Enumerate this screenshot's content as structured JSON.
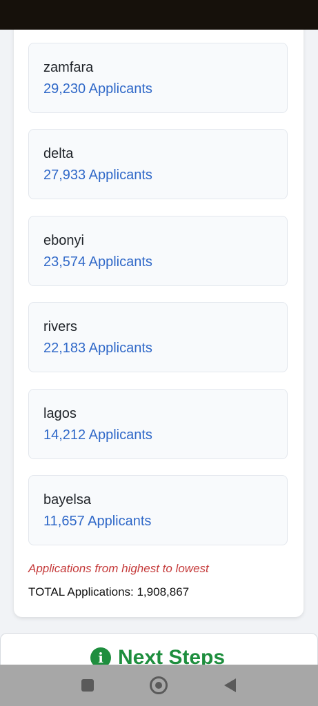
{
  "states": [
    {
      "name": "zamfara",
      "count": "29,230 Applicants"
    },
    {
      "name": "delta",
      "count": "27,933 Applicants"
    },
    {
      "name": "ebonyi",
      "count": "23,574 Applicants"
    },
    {
      "name": "rivers",
      "count": "22,183 Applicants"
    },
    {
      "name": "lagos",
      "count": "14,212 Applicants"
    },
    {
      "name": "bayelsa",
      "count": "11,657 Applicants"
    }
  ],
  "summary": {
    "note": "Applications from highest to lowest",
    "total": "TOTAL Applications: 1,908,867"
  },
  "next_steps": {
    "label": "Next Steps",
    "icon": "info-icon",
    "color": "#1e8e3e"
  },
  "nav": {
    "recents_icon": "square-icon",
    "home_icon": "circle-icon",
    "back_icon": "triangle-back-icon"
  }
}
